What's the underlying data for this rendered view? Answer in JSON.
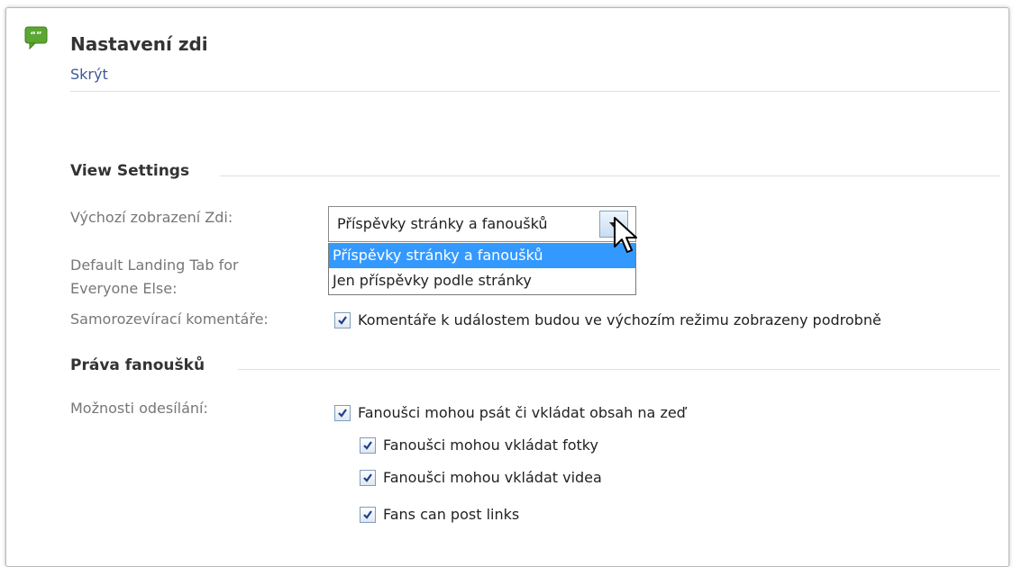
{
  "header": {
    "title": "Nastavení zdi",
    "hide_link": "Skrýt",
    "icon": "speech-bubble-icon",
    "accent_color": "#5ba732"
  },
  "view_settings": {
    "section_title": "View Settings",
    "default_wall_view": {
      "label": "Výchozí zobrazení Zdi:",
      "selected": "Příspěvky stránky a fanoušků",
      "options": [
        "Příspěvky stránky a fanoušků",
        "Jen příspěvky podle stránky"
      ],
      "highlighted_option_color": "#3399ff"
    },
    "default_landing_tab": {
      "label_line1": "Default Landing Tab for",
      "label_line2": "Everyone Else:"
    },
    "auto_expand_comments": {
      "label": "Samorozevírací komentáře:",
      "checkbox_label": "Komentáře k událostem budou ve výchozím režimu zobrazeny podrobně",
      "checked": true
    }
  },
  "fan_permissions": {
    "section_title": "Práva fanoušků",
    "posting_options": {
      "label": "Možnosti odesílání:",
      "main": {
        "label": "Fanoušci mohou psát či vkládat obsah na zeď",
        "checked": true
      },
      "sub": [
        {
          "label": "Fanoušci mohou vkládat fotky",
          "checked": true
        },
        {
          "label": "Fanoušci mohou vkládat videa",
          "checked": true
        },
        {
          "label": "Fans can post links",
          "checked": true
        }
      ]
    }
  },
  "link_color": "#3b5998"
}
